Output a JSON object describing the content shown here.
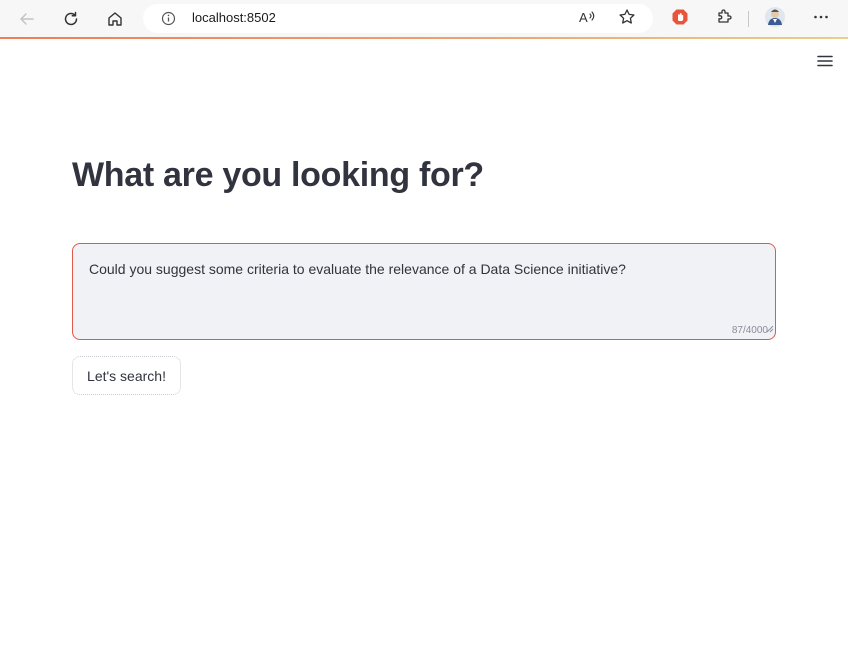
{
  "browser": {
    "url": "localhost:8502",
    "icons": [
      "back-arrow-icon",
      "refresh-icon",
      "home-icon",
      "info-icon",
      "read-aloud-icon",
      "favorite-star-icon",
      "adblock-extension-icon",
      "extensions-puzzle-icon",
      "profile-avatar",
      "more-options-icon"
    ]
  },
  "app": {
    "title": "What are you looking for?",
    "query": {
      "value": "Could you suggest some criteria to evaluate the relevance of a Data Science initiative?",
      "counter": "87/4000"
    },
    "search_button_label": "Let's search!",
    "menu_icon": "hamburger-menu-icon"
  },
  "colors": {
    "accent": "#e0594a",
    "text": "#31333f",
    "textarea_bg": "#f0f2f6"
  }
}
